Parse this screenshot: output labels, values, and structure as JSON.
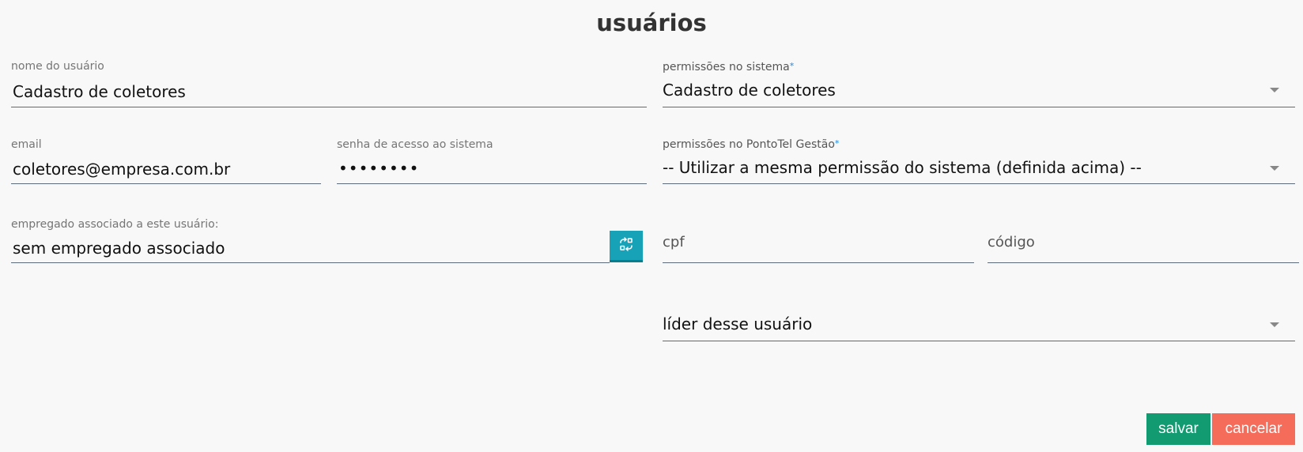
{
  "page": {
    "title": "usuários"
  },
  "form": {
    "nome_label": "nome do usuário",
    "nome_value": "Cadastro de coletores",
    "email_label": "email",
    "email_value": "coletores@empresa.com.br",
    "senha_label": "senha de acesso ao sistema",
    "senha_value": "••••••••",
    "empregado_label": "empregado associado a este usuário:",
    "empregado_value": "sem empregado associado",
    "perm_sistema_label": "permissões no sistema",
    "perm_sistema_value": "Cadastro de coletores",
    "perm_gestao_label": "permissões no PontoTel Gestão",
    "perm_gestao_value": "-- Utilizar a mesma permissão do sistema (definida acima) --",
    "required_mark": "*",
    "cpf_placeholder": "cpf",
    "codigo_placeholder": "código",
    "lider_placeholder": "líder desse usuário"
  },
  "actions": {
    "save_label": "salvar",
    "cancel_label": "cancelar"
  },
  "colors": {
    "save": "#129a70",
    "cancel": "#f56c5b",
    "swap_button": "#17a2b8",
    "required": "#1e88e5"
  },
  "icons": {
    "swap": "swap-icon",
    "dropdown": "caret-down-icon"
  }
}
